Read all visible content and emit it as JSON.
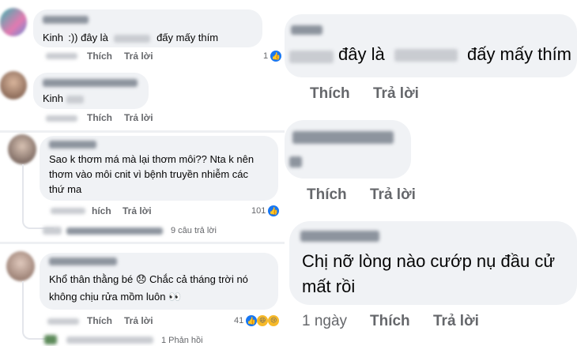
{
  "left": {
    "c1": {
      "text": "Kinh  :)) đây là",
      "text_tail": "đấy mấy thím",
      "like": "Thích",
      "reply": "Trả lời",
      "count": "1"
    },
    "c2": {
      "text": "Kinh",
      "like": "Thích",
      "reply": "Trả lời"
    },
    "c3": {
      "line1": "Sao k thơm má mà lại thơm môi?? Nta k nên",
      "line2": "thơm vào môi cnit vì bệnh truyền nhiễm các",
      "line3": "thứ ma",
      "like": "hích",
      "reply": "Trả lời",
      "count": "101",
      "replies": "9 câu trả lời"
    },
    "c4": {
      "line1": "Khổ thân thằng bé 😞 Chắc cả tháng trời nó",
      "line2": "không chịu rửa mồm luôn 👀",
      "like": "Thích",
      "reply": "Trả lời",
      "count": "41",
      "replies": "1 Phản hồi"
    }
  },
  "right": {
    "c1": {
      "text1": "đây là",
      "text2": "đấy mấy thím",
      "like": "Thích",
      "reply": "Trả lời"
    },
    "c2": {
      "like": "Thích",
      "reply": "Trả lời"
    },
    "c3": {
      "line1": "Chị nỡ lòng nào cướp nụ đầu cử",
      "line2": "mất rồi",
      "time": "1 ngày",
      "like": "Thích",
      "reply": "Trả lời"
    }
  },
  "colors": {
    "bubble": "#f0f2f5",
    "muted": "#65676b",
    "like_blue": "#1877f2"
  },
  "icons": [
    "like-icon",
    "haha-icon",
    "sad-icon"
  ]
}
